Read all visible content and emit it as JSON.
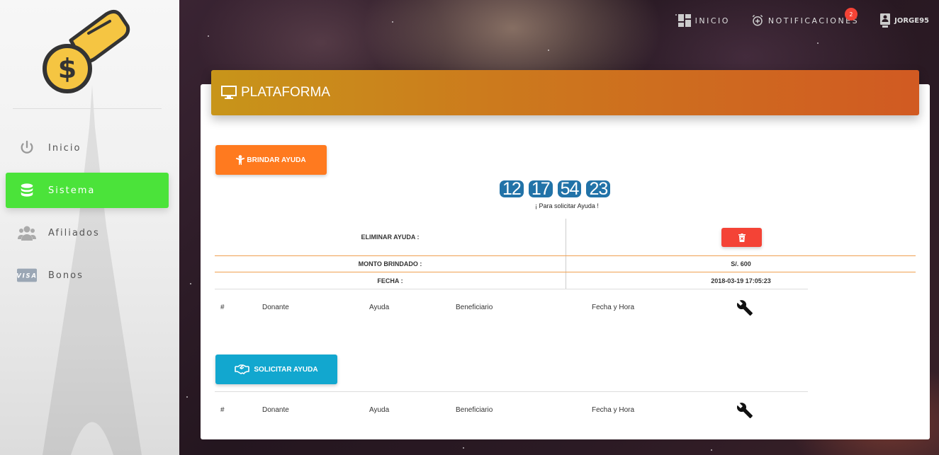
{
  "sidebar": {
    "items": [
      {
        "label": "Inicio",
        "icon": "power-icon",
        "active": false
      },
      {
        "label": "Sistema",
        "icon": "database-icon",
        "active": true
      },
      {
        "label": "Afiliados",
        "icon": "users-icon",
        "active": false
      },
      {
        "label": "Bonos",
        "icon": "visa-icon",
        "active": false
      }
    ]
  },
  "topnav": {
    "inicio": "INICIO",
    "notificaciones": "NOTIFICACIONES",
    "notif_count": "2",
    "user": "JORGE95"
  },
  "card": {
    "title": "PLATAFORMA",
    "brindar_label": "BRINDAR AYUDA",
    "solicitar_label": "SOLICITAR AYUDA",
    "countdown": [
      "12",
      "17",
      "54",
      "23"
    ],
    "countdown_label": "¡ Para solicitar Ayuda !",
    "eliminar_label": "ELIMINAR AYUDA :",
    "monto_label": "MONTO BRINDADO :",
    "monto_value": "S/. 600",
    "fecha_label": "FECHA :",
    "fecha_value": "2018-03-19 17:05:23"
  },
  "table_headers": [
    "#",
    "Donante",
    "Ayuda",
    "Beneficiario",
    "Fecha y Hora"
  ],
  "colors": {
    "active_nav": "#4be33a",
    "brindar": "#ff7a1f",
    "solicitar": "#12a7cf",
    "delete": "#f44336",
    "countdown": "#2273a8"
  }
}
